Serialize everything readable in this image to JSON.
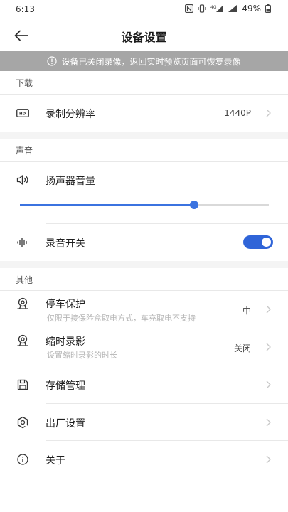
{
  "status": {
    "time": "6:13",
    "network": "4G",
    "battery": "49%"
  },
  "header": {
    "title": "设备设置"
  },
  "banner": {
    "text": "设备已关闭录像，返回实时预览页面可恢复录像"
  },
  "sections": {
    "download": "下载",
    "sound": "声音",
    "other": "其他"
  },
  "download": {
    "resolution_label": "录制分辨率",
    "resolution_value": "1440P"
  },
  "sound": {
    "volume_label": "扬声器音量",
    "volume_level": 0.7,
    "record_label": "录音开关",
    "record_on": true
  },
  "other": {
    "parking_label": "停车保护",
    "parking_sub": "仅限于接保险盒取电方式，车充取电不支持",
    "parking_value": "中",
    "timelapse_label": "缩时录影",
    "timelapse_sub": "设置缩时录影的时长",
    "timelapse_value": "关闭",
    "storage_label": "存储管理",
    "factory_label": "出厂设置",
    "about_label": "关于"
  },
  "colors": {
    "accent": "#3b73e0",
    "toggle": "#2f64d8",
    "banner": "#a6a6a6"
  }
}
